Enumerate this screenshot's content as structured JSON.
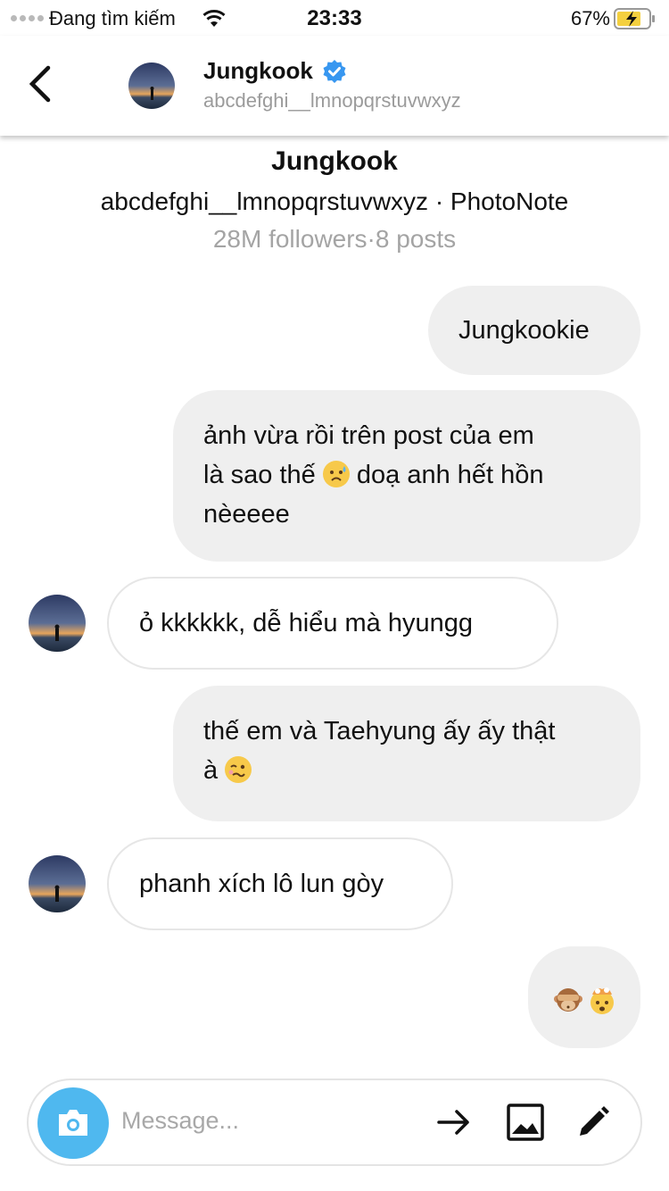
{
  "status_bar": {
    "carrier": "Đang tìm kiếm",
    "time": "23:33",
    "battery": "67%"
  },
  "header": {
    "name": "Jungkook",
    "username": "abcdefghi__lmnopqrstuvwxyz",
    "icons": [
      "back-chevron-icon",
      "verified-badge-icon"
    ]
  },
  "profile": {
    "name": "Jungkook",
    "subtitle": "abcdefghi__lmnopqrstuvwxyz · PhotoNote",
    "stats": "28M followers·8 posts"
  },
  "messages": [
    {
      "side": "out",
      "lines": [
        "Jungkookie"
      ]
    },
    {
      "side": "out",
      "lines": [
        "ảnh vừa rồi trên post của em",
        "là sao thế",
        "doạ anh hết hồn",
        "nèeeee"
      ]
    },
    {
      "side": "in",
      "lines": [
        "ỏ kkkkkk, dễ hiểu mà hyungg"
      ]
    },
    {
      "side": "out",
      "lines": [
        "thế em và Taehyung ấy ấy thật",
        "à"
      ]
    },
    {
      "side": "in",
      "lines": [
        "phanh xích lô lun gòy"
      ]
    },
    {
      "side": "out",
      "lines": []
    }
  ],
  "composer": {
    "placeholder": "Message...",
    "icons": [
      "camera-icon",
      "send-arrow-icon",
      "gallery-icon",
      "pencil-icon"
    ]
  },
  "colors": {
    "camera_button": "#4fb8ef",
    "verified": "#3897f0",
    "outgoing_bubble": "#efefef"
  }
}
